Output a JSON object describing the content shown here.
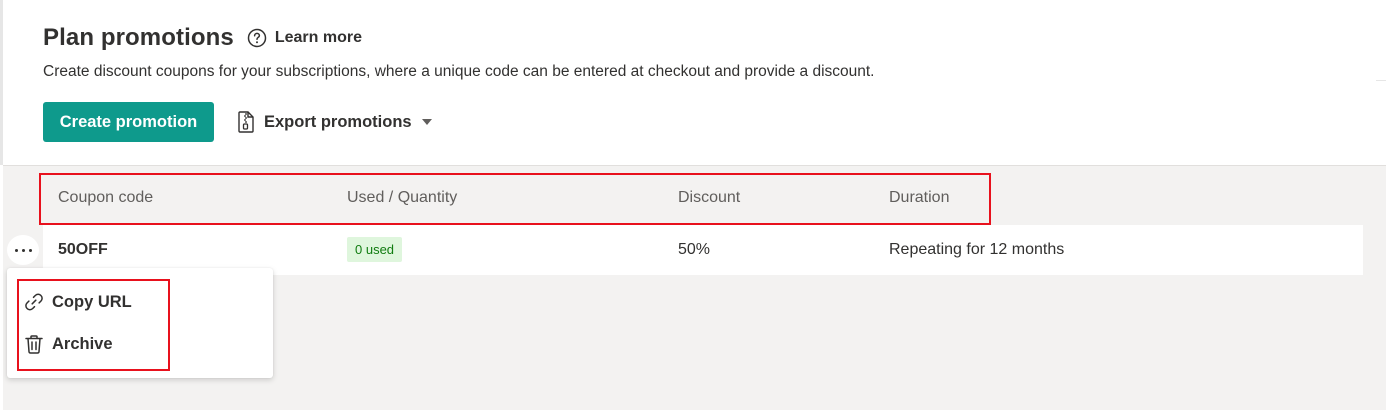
{
  "header": {
    "title": "Plan promotions",
    "learn_more": "Learn more",
    "subtitle": "Create discount coupons for your subscriptions, where a unique code can be entered at checkout and provide a discount."
  },
  "toolbar": {
    "create_label": "Create promotion",
    "export_label": "Export promotions"
  },
  "table": {
    "columns": [
      "Coupon code",
      "Used / Quantity",
      "Discount",
      "Duration"
    ],
    "rows": [
      {
        "code": "50OFF",
        "used": "0 used",
        "discount": "50%",
        "duration": "Repeating for 12 months"
      }
    ]
  },
  "context_menu": {
    "items": [
      {
        "label": "Copy URL",
        "icon": "link-icon"
      },
      {
        "label": "Archive",
        "icon": "trash-icon"
      }
    ]
  },
  "colors": {
    "primary": "#0e9a8c",
    "highlight_outline": "#e8111d",
    "badge_bg": "#dff6dd",
    "badge_text": "#107c10"
  }
}
